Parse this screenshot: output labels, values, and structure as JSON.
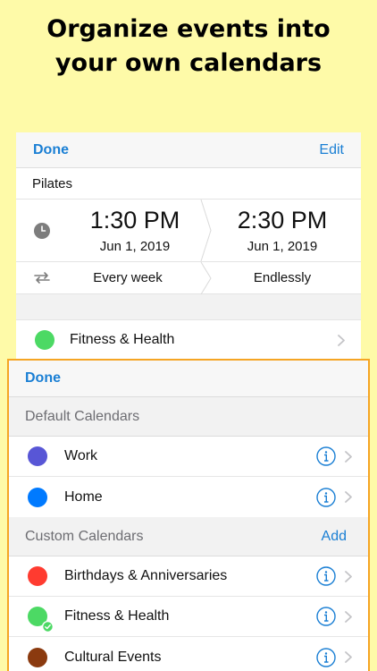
{
  "headline": {
    "line1": "Organize events into",
    "line2": "your own calendars"
  },
  "event": {
    "done_label": "Done",
    "edit_label": "Edit",
    "title": "Pilates",
    "start_time": "1:30 PM",
    "start_date": "Jun 1, 2019",
    "end_time": "2:30 PM",
    "end_date": "Jun 1, 2019",
    "repeat": "Every week",
    "repeat_end": "Endlessly",
    "calendar": {
      "name": "Fitness & Health",
      "color": "#4cd964"
    }
  },
  "picker": {
    "done_label": "Done",
    "default_header": "Default Calendars",
    "custom_header": "Custom Calendars",
    "add_label": "Add",
    "default_calendars": [
      {
        "name": "Work",
        "color": "#5856d6"
      },
      {
        "name": "Home",
        "color": "#007aff"
      }
    ],
    "custom_calendars": [
      {
        "name": "Birthdays & Anniversaries",
        "color": "#ff3b30"
      },
      {
        "name": "Fitness & Health",
        "color": "#4cd964",
        "selected": true
      },
      {
        "name": "Cultural Events",
        "color": "#8b3a0f"
      }
    ]
  },
  "colors": {
    "accent": "#1a7fd4",
    "highlight_border": "#f5a524",
    "background": "#fefaa8"
  }
}
